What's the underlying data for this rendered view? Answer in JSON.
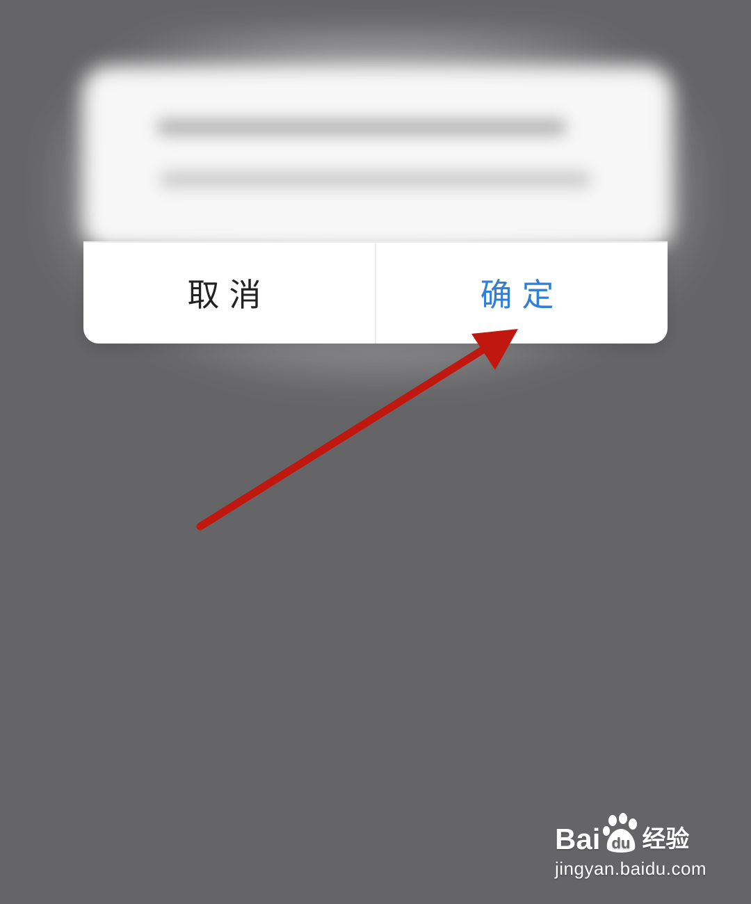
{
  "dialog": {
    "cancel_label": "取消",
    "confirm_label": "确定"
  },
  "colors": {
    "confirm_text": "#2f7ed8",
    "cancel_text": "#222222",
    "arrow": "#c0180f",
    "backdrop": "#656567"
  },
  "annotation": {
    "icon": "arrow-icon"
  },
  "watermark": {
    "brand_latin_1": "Bai",
    "brand_latin_2": "du",
    "brand_cn": "经验",
    "url": "jingyan.baidu.com"
  }
}
